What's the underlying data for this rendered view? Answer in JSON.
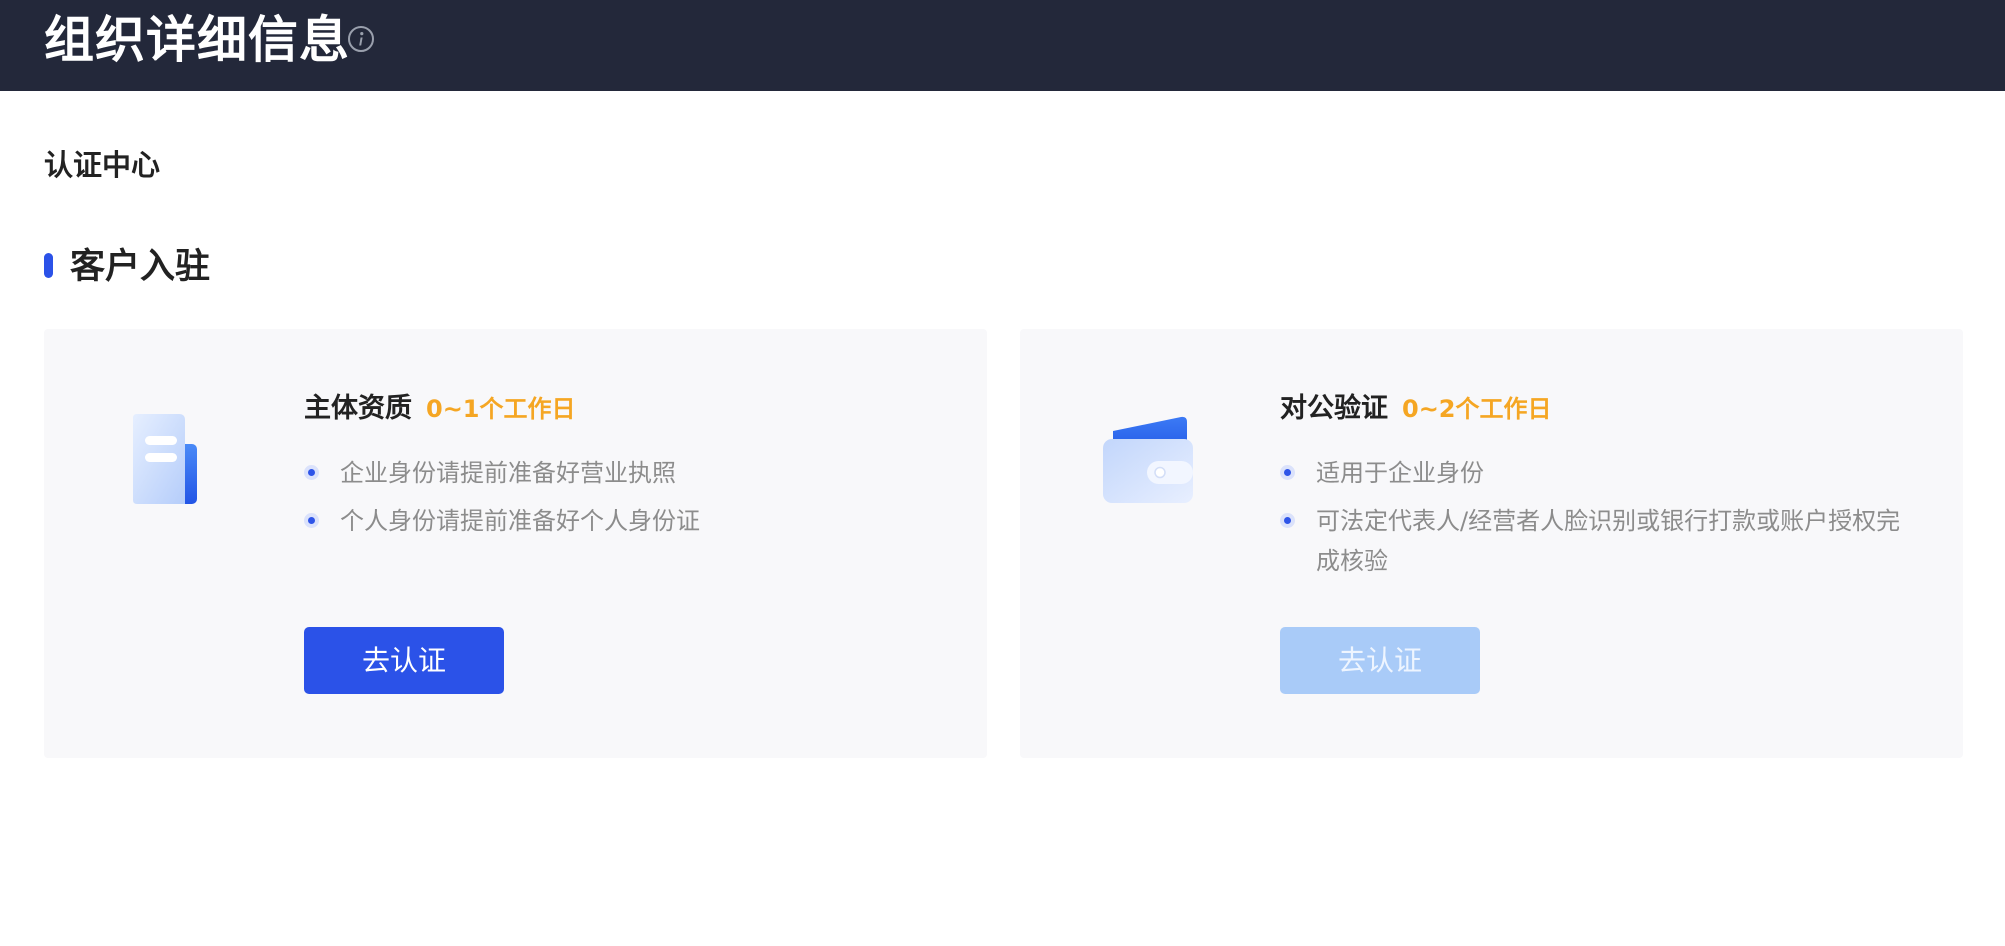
{
  "header": {
    "title": "组织详细信息",
    "info_icon": "info-icon"
  },
  "section": {
    "title": "认证中心",
    "subsection_title": "客户入驻",
    "accent_color": "#2b52e8"
  },
  "cards": [
    {
      "icon": "document-icon",
      "title": "主体资质",
      "duration": "0~1个工作日",
      "bullets": [
        "企业身份请提前准备好营业执照",
        "个人身份请提前准备好个人身份证"
      ],
      "button_label": "去认证",
      "button_state": "enabled"
    },
    {
      "icon": "wallet-icon",
      "title": "对公验证",
      "duration": "0~2个工作日",
      "bullets": [
        "适用于企业身份",
        "可法定代表人/经营者人脸识别或银行打款或账户授权完成核验"
      ],
      "button_label": "去认证",
      "button_state": "disabled"
    }
  ],
  "colors": {
    "header_bg": "#23283a",
    "duration": "#f5a623",
    "button_primary": "#2b52e8",
    "button_disabled": "#a9cbf8"
  }
}
